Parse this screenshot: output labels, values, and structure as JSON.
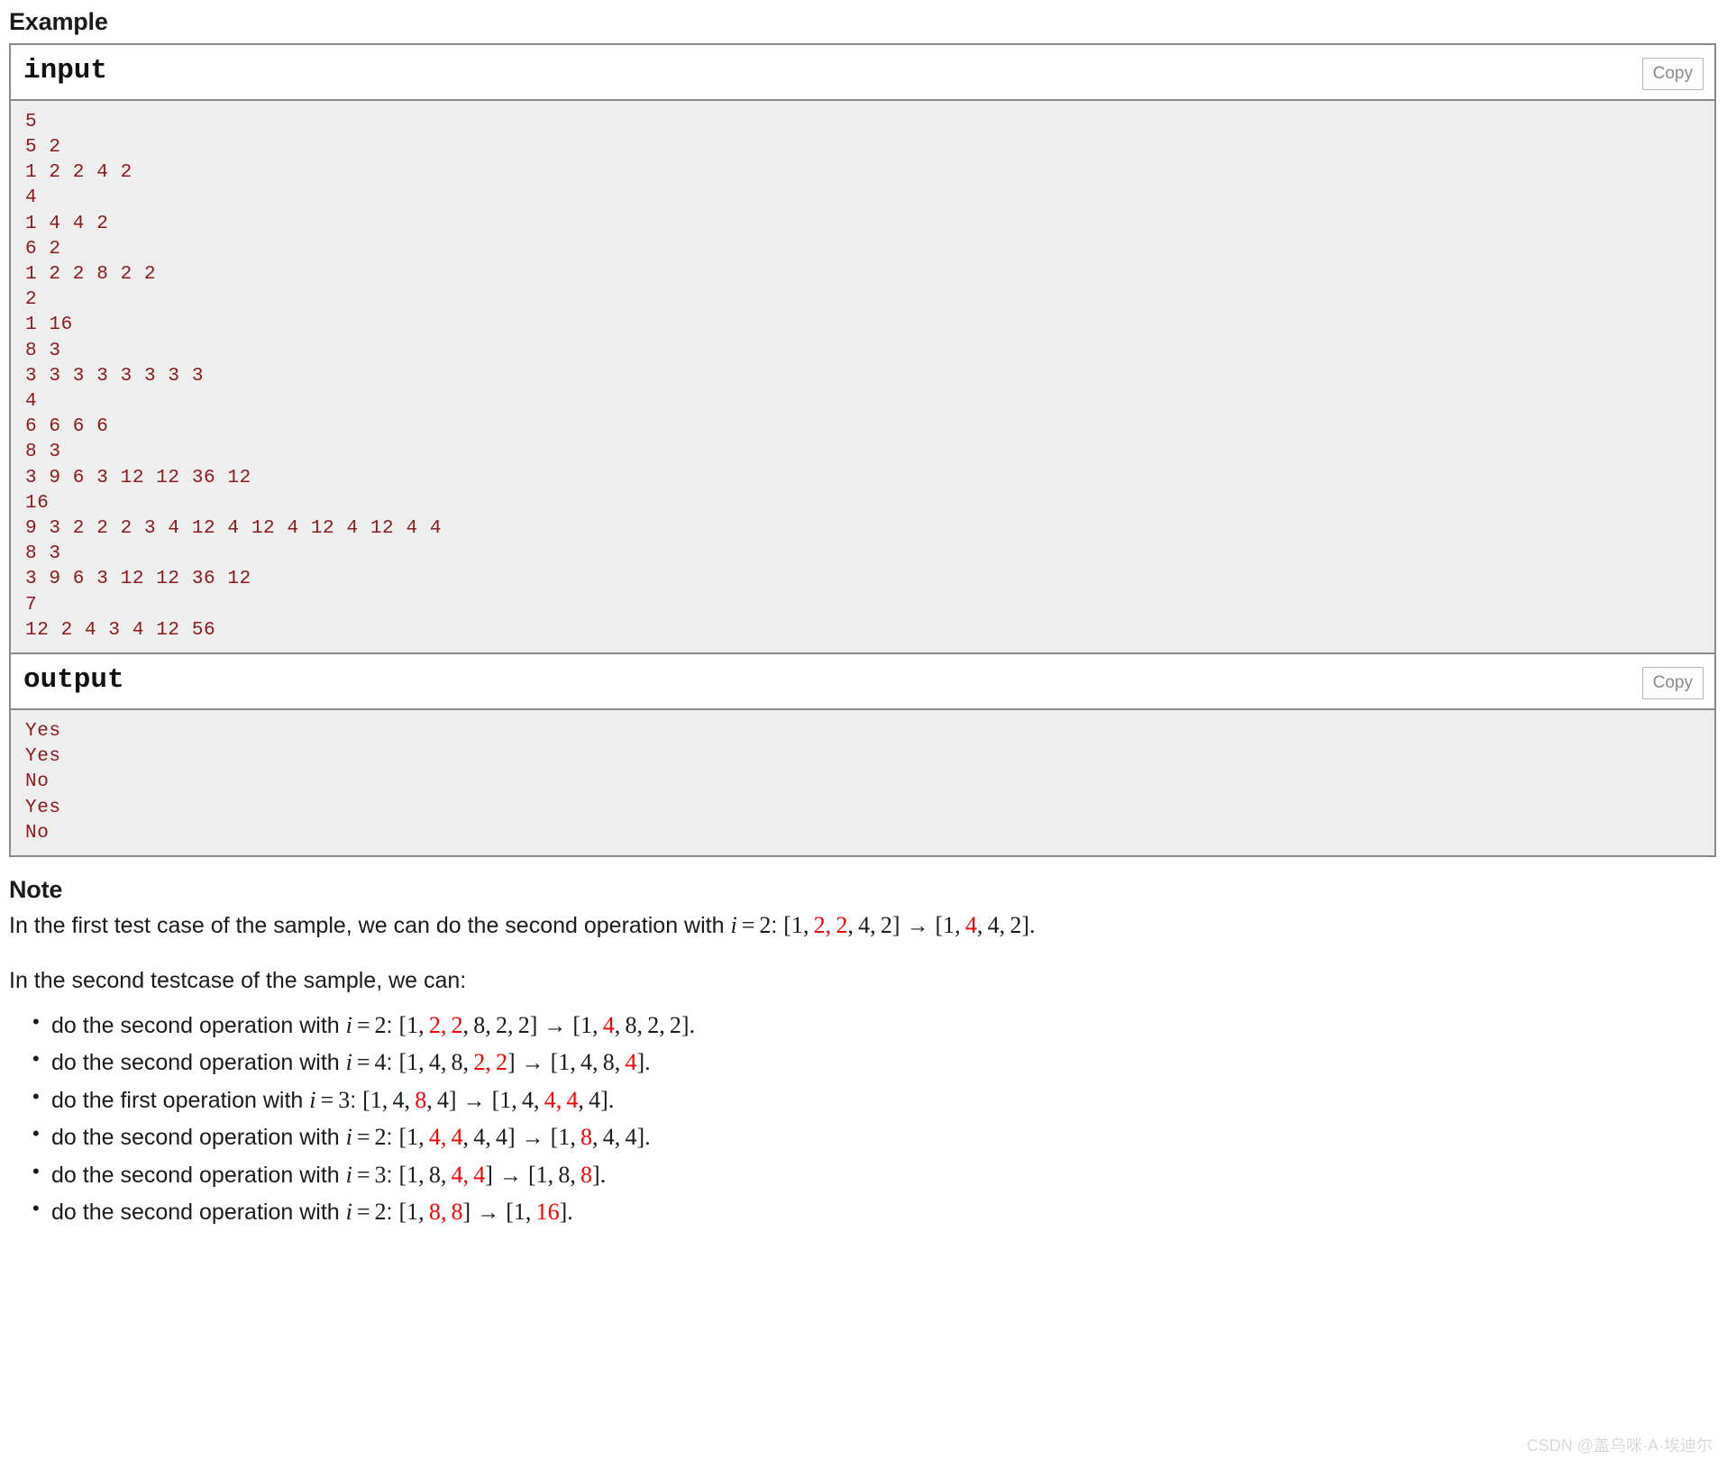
{
  "example": {
    "heading": "Example",
    "input": {
      "title": "input",
      "copy_label": "Copy",
      "lines": [
        "5",
        "5 2",
        "1 2 2 4 2",
        "4",
        "1 4 4 2",
        "6 2",
        "1 2 2 8 2 2",
        "2",
        "1 16",
        "8 3",
        "3 3 3 3 3 3 3 3",
        "4",
        "6 6 6 6",
        "8 3",
        "3 9 6 3 12 12 36 12",
        "16",
        "9 3 2 2 2 3 4 12 4 12 4 12 4 12 4 4",
        "8 3",
        "3 9 6 3 12 12 36 12",
        "7",
        "12 2 4 3 4 12 56"
      ]
    },
    "output": {
      "title": "output",
      "copy_label": "Copy",
      "lines": [
        "Yes",
        "Yes",
        "No",
        "Yes",
        "No"
      ]
    }
  },
  "note": {
    "heading": "Note",
    "paragraph1": {
      "text_before": "In the first test case of the sample, we can do the second operation with ",
      "var": "i",
      "eq": "=",
      "value": "2",
      "colon": ":",
      "from": [
        {
          "t": "1",
          "red": false
        },
        {
          "t": "2",
          "red": true
        },
        {
          "t": "2",
          "red": true
        },
        {
          "t": "4",
          "red": false
        },
        {
          "t": "2",
          "red": false
        }
      ],
      "to": [
        {
          "t": "1",
          "red": false
        },
        {
          "t": "4",
          "red": true
        },
        {
          "t": "4",
          "red": false
        },
        {
          "t": "2",
          "red": false
        }
      ],
      "period": "."
    },
    "paragraph2": "In the second testcase of the sample, we can:",
    "steps": [
      {
        "text_before": "do the second operation with ",
        "var": "i",
        "eq": "=",
        "value": "2",
        "colon": ":",
        "from": [
          {
            "t": "1",
            "red": false
          },
          {
            "t": "2",
            "red": true
          },
          {
            "t": "2",
            "red": true
          },
          {
            "t": "8",
            "red": false
          },
          {
            "t": "2",
            "red": false
          },
          {
            "t": "2",
            "red": false
          }
        ],
        "to": [
          {
            "t": "1",
            "red": false
          },
          {
            "t": "4",
            "red": true
          },
          {
            "t": "8",
            "red": false
          },
          {
            "t": "2",
            "red": false
          },
          {
            "t": "2",
            "red": false
          }
        ],
        "period": "."
      },
      {
        "text_before": "do the second operation with ",
        "var": "i",
        "eq": "=",
        "value": "4",
        "colon": ":",
        "from": [
          {
            "t": "1",
            "red": false
          },
          {
            "t": "4",
            "red": false
          },
          {
            "t": "8",
            "red": false
          },
          {
            "t": "2",
            "red": true
          },
          {
            "t": "2",
            "red": true
          }
        ],
        "to": [
          {
            "t": "1",
            "red": false
          },
          {
            "t": "4",
            "red": false
          },
          {
            "t": "8",
            "red": false
          },
          {
            "t": "4",
            "red": true
          }
        ],
        "period": "."
      },
      {
        "text_before": "do the first operation with ",
        "var": "i",
        "eq": "=",
        "value": "3",
        "colon": ":",
        "from": [
          {
            "t": "1",
            "red": false
          },
          {
            "t": "4",
            "red": false
          },
          {
            "t": "8",
            "red": true
          },
          {
            "t": "4",
            "red": false
          }
        ],
        "to": [
          {
            "t": "1",
            "red": false
          },
          {
            "t": "4",
            "red": false
          },
          {
            "t": "4",
            "red": true
          },
          {
            "t": "4",
            "red": true
          },
          {
            "t": "4",
            "red": false
          }
        ],
        "period": "."
      },
      {
        "text_before": "do the second operation with ",
        "var": "i",
        "eq": "=",
        "value": "2",
        "colon": ":",
        "from": [
          {
            "t": "1",
            "red": false
          },
          {
            "t": "4",
            "red": true
          },
          {
            "t": "4",
            "red": true
          },
          {
            "t": "4",
            "red": false
          },
          {
            "t": "4",
            "red": false
          }
        ],
        "to": [
          {
            "t": "1",
            "red": false
          },
          {
            "t": "8",
            "red": true
          },
          {
            "t": "4",
            "red": false
          },
          {
            "t": "4",
            "red": false
          }
        ],
        "period": "."
      },
      {
        "text_before": "do the second operation with ",
        "var": "i",
        "eq": "=",
        "value": "3",
        "colon": ":",
        "from": [
          {
            "t": "1",
            "red": false
          },
          {
            "t": "8",
            "red": false
          },
          {
            "t": "4",
            "red": true
          },
          {
            "t": "4",
            "red": true
          }
        ],
        "to": [
          {
            "t": "1",
            "red": false
          },
          {
            "t": "8",
            "red": false
          },
          {
            "t": "8",
            "red": true
          }
        ],
        "period": "."
      },
      {
        "text_before": "do the second operation with ",
        "var": "i",
        "eq": "=",
        "value": "2",
        "colon": ":",
        "from": [
          {
            "t": "1",
            "red": false
          },
          {
            "t": "8",
            "red": true
          },
          {
            "t": "8",
            "red": true
          }
        ],
        "to": [
          {
            "t": "1",
            "red": false
          },
          {
            "t": "16",
            "red": true
          }
        ],
        "period": "."
      }
    ]
  },
  "watermark": "CSDN @盖乌咪·A·埃迪尔",
  "colors": {
    "io_text": "#8b1a1a",
    "io_background": "#eeeeee",
    "border": "#8a8a8a",
    "math_red": "#ff0000",
    "copy_text": "#8a8a8a",
    "watermark": "#d8d8d8"
  }
}
